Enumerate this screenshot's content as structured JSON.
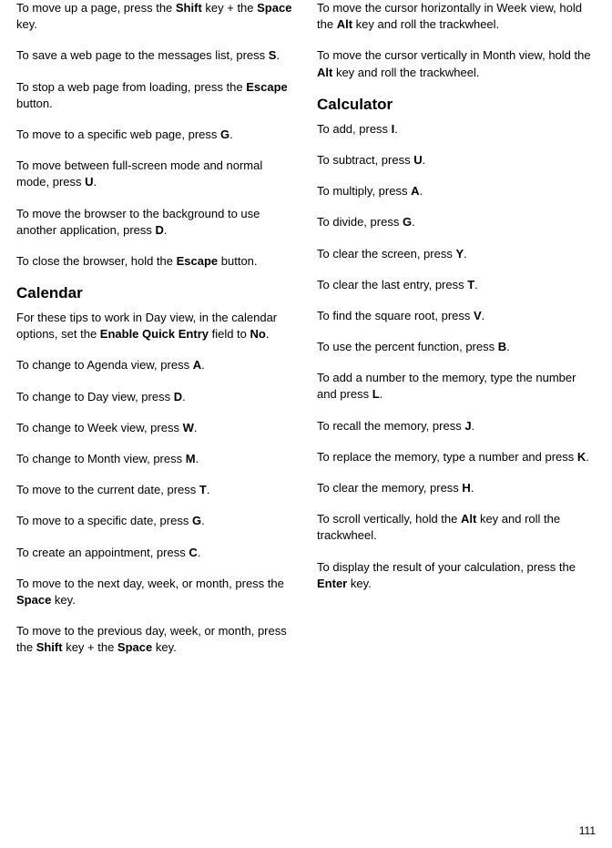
{
  "left": {
    "p1": {
      "t1": "To move up a page, press the ",
      "b1": "Shift",
      "t2": " key + the ",
      "b2": "Space",
      "t3": " key."
    },
    "p2": {
      "t1": "To save a web page to the messages list, press ",
      "b1": "S",
      "t2": "."
    },
    "p3": {
      "t1": "To stop a web page from loading, press the ",
      "b1": "Escape",
      "t2": " button."
    },
    "p4": {
      "t1": "To move to a specific web page, press ",
      "b1": "G",
      "t2": "."
    },
    "p5": {
      "t1": "To move between full-screen mode and normal mode, press ",
      "b1": "U",
      "t2": "."
    },
    "p6": {
      "t1": "To move the browser to the background to use another application, press ",
      "b1": "D",
      "t2": "."
    },
    "p7": {
      "t1": "To close the browser, hold the ",
      "b1": "Escape",
      "t2": " button."
    },
    "h1": "Calendar",
    "p8": {
      "t1": "For these tips to work in Day view, in the calendar options, set the ",
      "b1": "Enable Quick Entry",
      "t2": " field to ",
      "b2": "No",
      "t3": "."
    },
    "p9": {
      "t1": "To change to Agenda view, press ",
      "b1": "A",
      "t2": "."
    },
    "p10": {
      "t1": "To change to Day view, press ",
      "b1": "D",
      "t2": "."
    },
    "p11": {
      "t1": "To change to Week view, press ",
      "b1": "W",
      "t2": "."
    },
    "p12": {
      "t1": "To change to Month view, press ",
      "b1": "M",
      "t2": "."
    },
    "p13": {
      "t1": "To move to the current date, press ",
      "b1": "T",
      "t2": "."
    },
    "p14": {
      "t1": "To move to a specific date, press ",
      "b1": "G",
      "t2": "."
    },
    "p15": {
      "t1": "To create an appointment, press ",
      "b1": "C",
      "t2": "."
    },
    "p16": {
      "t1": "To move to the next day, week, or month, press the ",
      "b1": "Space",
      "t2": " key."
    },
    "p17": {
      "t1": "To move to the previous day, week, or month, press the ",
      "b1": "Shift",
      "t2": " key + the ",
      "b2": "Space",
      "t3": " key."
    }
  },
  "right": {
    "p1": {
      "t1": "To move the cursor horizontally in Week view, hold the ",
      "b1": "Alt",
      "t2": " key and roll the trackwheel."
    },
    "p2": {
      "t1": "To move the cursor vertically in Month view, hold the ",
      "b1": "Alt",
      "t2": " key and roll the trackwheel."
    },
    "h1": "Calculator",
    "p3": {
      "t1": "To add, press ",
      "b1": "I",
      "t2": "."
    },
    "p4": {
      "t1": "To subtract, press ",
      "b1": "U",
      "t2": "."
    },
    "p5": {
      "t1": "To multiply, press ",
      "b1": "A",
      "t2": "."
    },
    "p6": {
      "t1": "To divide, press ",
      "b1": "G",
      "t2": "."
    },
    "p7": {
      "t1": "To clear the screen, press ",
      "b1": "Y",
      "t2": "."
    },
    "p8": {
      "t1": "To clear the last entry, press ",
      "b1": "T",
      "t2": "."
    },
    "p9": {
      "t1": "To find the square root, press ",
      "b1": "V",
      "t2": "."
    },
    "p10": {
      "t1": "To use the percent function, press ",
      "b1": "B",
      "t2": "."
    },
    "p11": {
      "t1": "To add a number to the memory, type the number and press ",
      "b1": "L",
      "t2": "."
    },
    "p12": {
      "t1": "To recall the memory, press ",
      "b1": "J",
      "t2": "."
    },
    "p13": {
      "t1": "To replace the memory, type a number and press ",
      "b1": "K",
      "t2": "."
    },
    "p14": {
      "t1": "To clear the memory, press ",
      "b1": "H",
      "t2": "."
    },
    "p15": {
      "t1": "To scroll vertically, hold the ",
      "b1": "Alt",
      "t2": " key and roll the trackwheel."
    },
    "p16": {
      "t1": "To display the result of your calculation, press the ",
      "b1": "Enter",
      "t2": " key."
    }
  },
  "pagenum": "111"
}
